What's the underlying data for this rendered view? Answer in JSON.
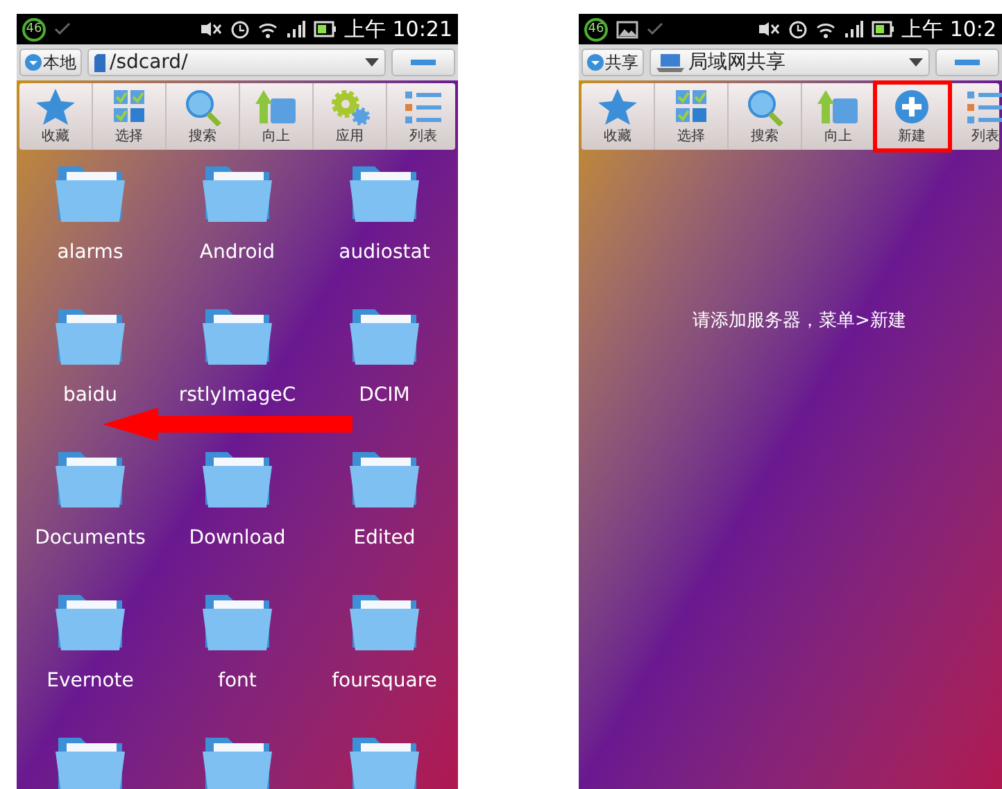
{
  "phones": [
    {
      "status_bar": {
        "badge": "46",
        "image_icon": false,
        "time": "上午 10:21"
      },
      "location_button": "本地",
      "path": {
        "kind": "sdcard",
        "text": "/sdcard/"
      },
      "toolbar": [
        {
          "label": "收藏",
          "kind": "star",
          "highlighted": false
        },
        {
          "label": "选择",
          "kind": "select",
          "highlighted": false
        },
        {
          "label": "搜索",
          "kind": "search",
          "highlighted": false
        },
        {
          "label": "向上",
          "kind": "up",
          "highlighted": false
        },
        {
          "label": "应用",
          "kind": "gear",
          "highlighted": false
        },
        {
          "label": "列表",
          "kind": "list",
          "highlighted": false
        }
      ],
      "folders": [
        {
          "kind": "folder",
          "label": "alarms"
        },
        {
          "kind": "folder",
          "label": "Android"
        },
        {
          "kind": "folder",
          "label": "audiostat"
        },
        {
          "kind": "folder",
          "label": "baidu"
        },
        {
          "kind": "folder",
          "label": "rstlyImageC"
        },
        {
          "kind": "folder",
          "label": "DCIM"
        },
        {
          "kind": "folder",
          "label": "Documents"
        },
        {
          "kind": "folder",
          "label": "Download"
        },
        {
          "kind": "folder",
          "label": "Edited"
        },
        {
          "kind": "folder",
          "label": "Evernote"
        },
        {
          "kind": "folder",
          "label": "font"
        },
        {
          "kind": "folder",
          "label": "foursquare"
        },
        {
          "kind": "cut-off"
        },
        {
          "kind": "cut-off"
        },
        {
          "kind": "cut-off"
        }
      ],
      "annotation": {
        "kind": "arrow-left"
      }
    },
    {
      "status_bar": {
        "badge": "46",
        "image_icon": true,
        "time": "上午 10:2"
      },
      "location_button": "共享",
      "path": {
        "kind": "network",
        "text": "局域网共享"
      },
      "toolbar": [
        {
          "label": "收藏",
          "kind": "star",
          "highlighted": false
        },
        {
          "label": "选择",
          "kind": "select",
          "highlighted": false
        },
        {
          "label": "搜索",
          "kind": "search",
          "highlighted": false
        },
        {
          "label": "向上",
          "kind": "up",
          "highlighted": false
        },
        {
          "label": "新建",
          "kind": "plus",
          "highlighted": true
        },
        {
          "label": "列表",
          "kind": "list",
          "highlighted": false
        }
      ],
      "message": "请添加服务器，菜单>新建"
    }
  ]
}
